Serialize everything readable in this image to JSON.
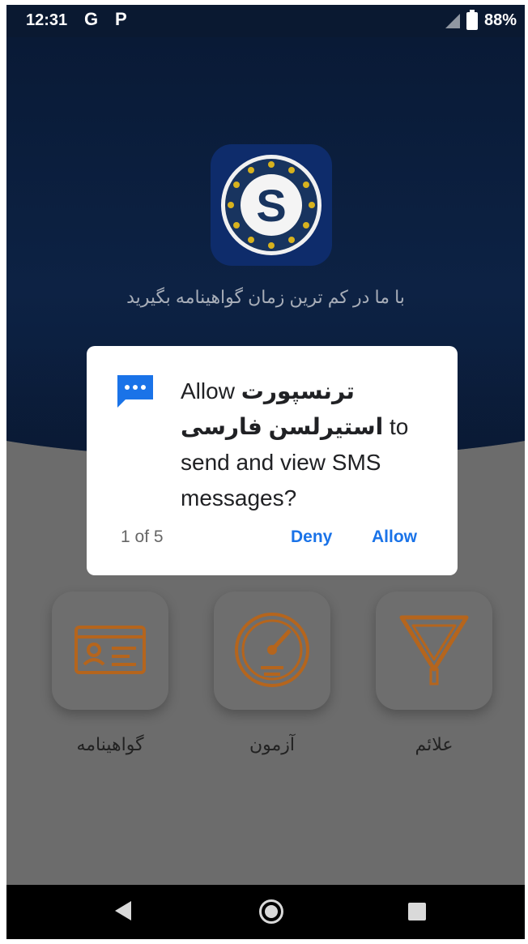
{
  "status_bar": {
    "time": "12:31",
    "notif_g": "G",
    "notif_p": "P",
    "battery": "88%",
    "icons": [
      "g-notification-icon",
      "p-notification-icon",
      "signal-icon",
      "battery-charging-icon"
    ]
  },
  "hero": {
    "tagline": "با ما در کم ترین زمان گواهینامه بگیرید",
    "logo_letter": "S"
  },
  "cards": [
    {
      "label": "علائم",
      "icon": "yield-sign-icon"
    },
    {
      "label": "آزمون",
      "icon": "speedometer-icon"
    },
    {
      "label": "گواهینامه",
      "icon": "license-card-icon"
    }
  ],
  "dialog": {
    "prefix": "Allow ",
    "app_name": "ترنسپورت استیرلسن فارسی",
    "suffix": " to send and view SMS messages?",
    "counter": "1 of 5",
    "deny": "Deny",
    "allow": "Allow",
    "icon": "sms-icon"
  },
  "nav": {
    "icons": [
      "back-icon",
      "home-icon",
      "recents-icon"
    ]
  },
  "colors": {
    "accent": "#1a73e8",
    "hero": "#0d2244",
    "card_icon": "#b5651d"
  }
}
